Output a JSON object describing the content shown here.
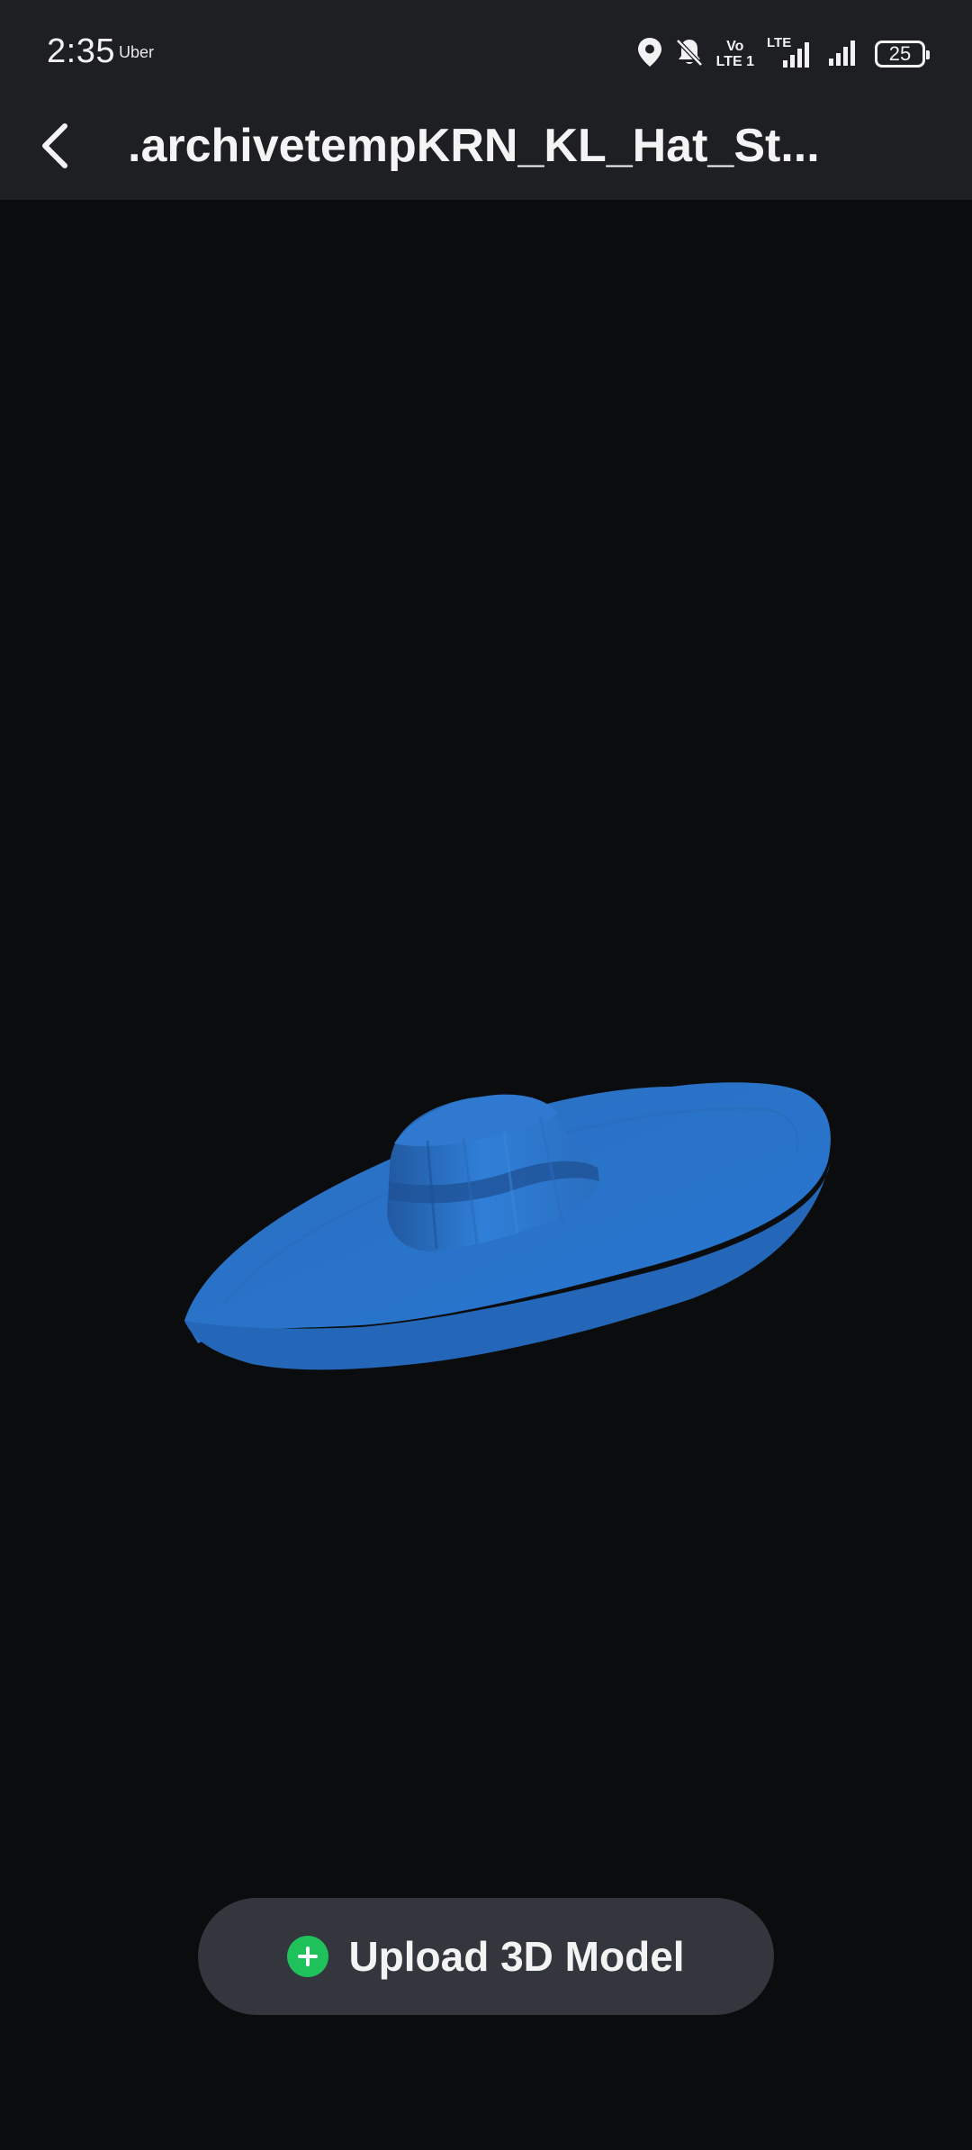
{
  "status_bar": {
    "time": "2:35",
    "app_name": "Uber",
    "volte_top": "Vo",
    "volte_bottom": "LTE 1",
    "lte_label": "LTE",
    "battery_level": "25"
  },
  "app_bar": {
    "title": ".archivetempKRN_KL_Hat_St..."
  },
  "viewer": {
    "model_color": "#2b78d2"
  },
  "upload": {
    "label": "Upload 3D Model"
  },
  "colors": {
    "background": "#0b0c0e",
    "topbar": "#1d1f23",
    "button": "#34363d",
    "accent_green": "#1fc15a"
  }
}
